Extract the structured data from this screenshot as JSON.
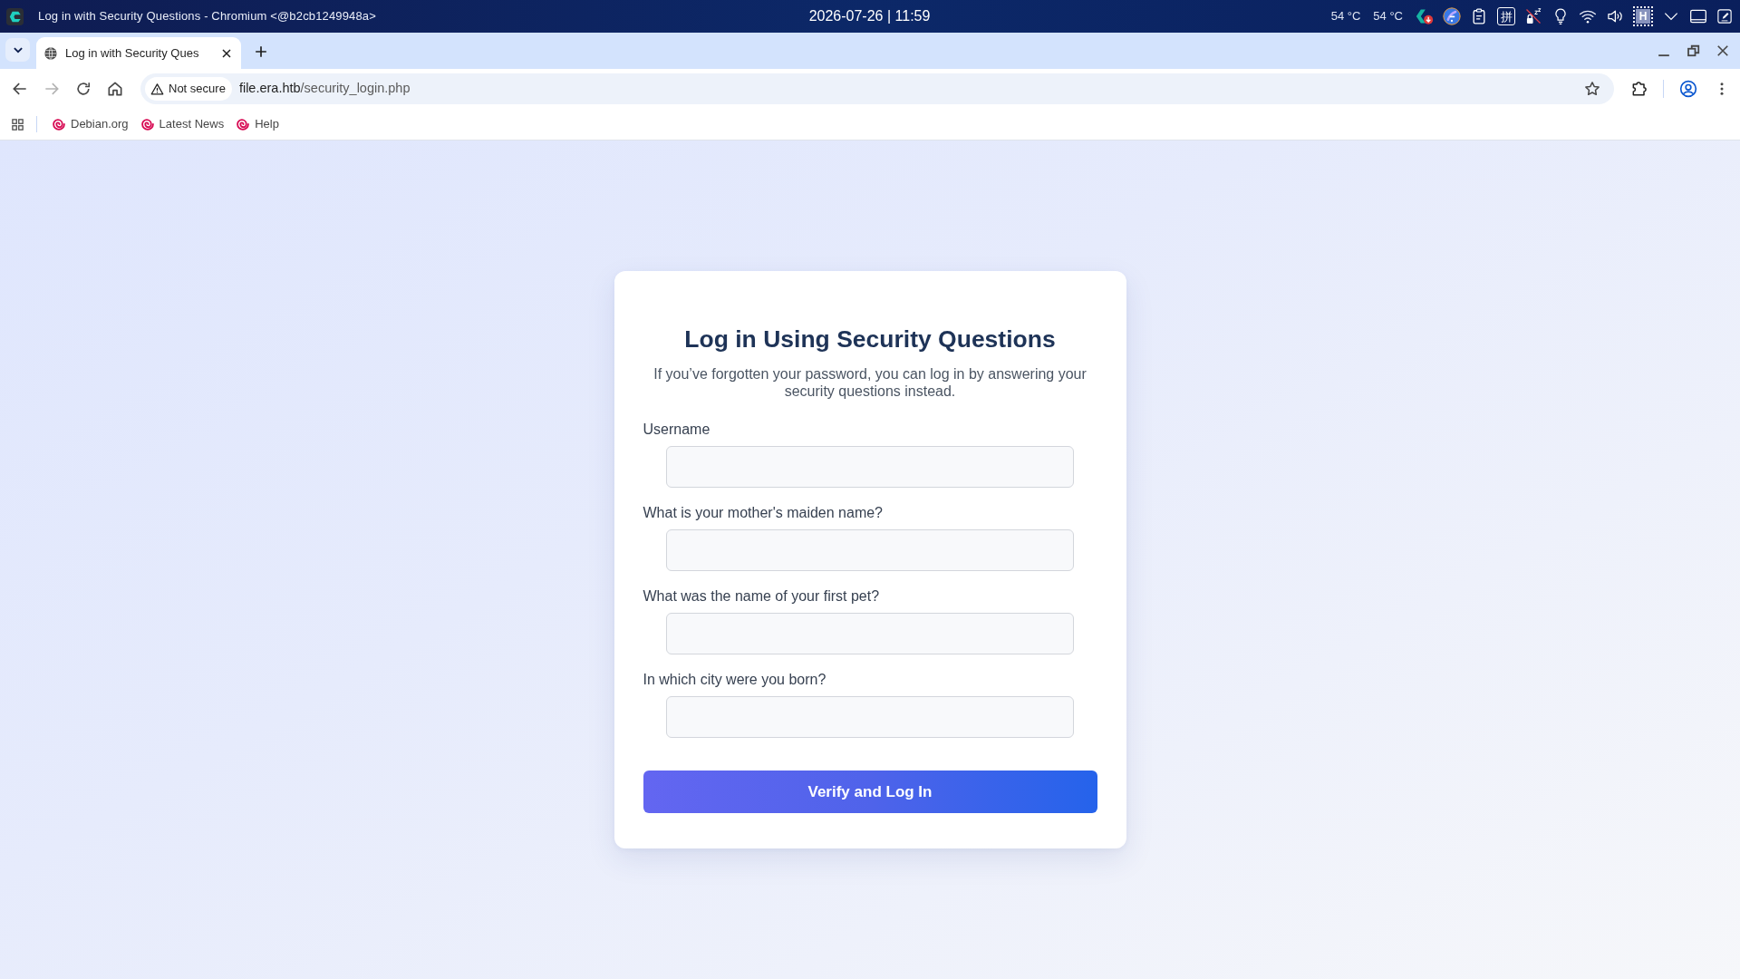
{
  "system_bar": {
    "window_title": "Log in with Security Questions - Chromium <@b2cb1249948a>",
    "clock": "2026-07-26 | 11:59",
    "temperatures": [
      "54 °C",
      "54 °C"
    ],
    "input_method": "拼",
    "cpu_indicator": "H"
  },
  "browser": {
    "tabs": [
      {
        "title": "Log in with Security Ques",
        "selected": true
      }
    ],
    "nav_buttons": [
      {
        "kind": "back",
        "disabled": false
      },
      {
        "kind": "forward",
        "disabled": true
      },
      {
        "kind": "reload",
        "disabled": false
      },
      {
        "kind": "home",
        "disabled": false
      }
    ],
    "security_chip": "Not secure",
    "url": {
      "host": "file.era.htb",
      "path": "/security_login.php"
    },
    "bookmarks": [
      "Debian.org",
      "Latest News",
      "Help"
    ]
  },
  "page": {
    "title": "Log in Using Security Questions",
    "subtitle": "If you’ve forgotten your password, you can log in by answering your security questions instead.",
    "fields": [
      {
        "label": "Username"
      },
      {
        "label": "What is your mother's maiden name?"
      },
      {
        "label": "What was the name of your first pet?"
      },
      {
        "label": "In which city were you born?"
      }
    ],
    "submit_button": "Verify and Log In"
  }
}
